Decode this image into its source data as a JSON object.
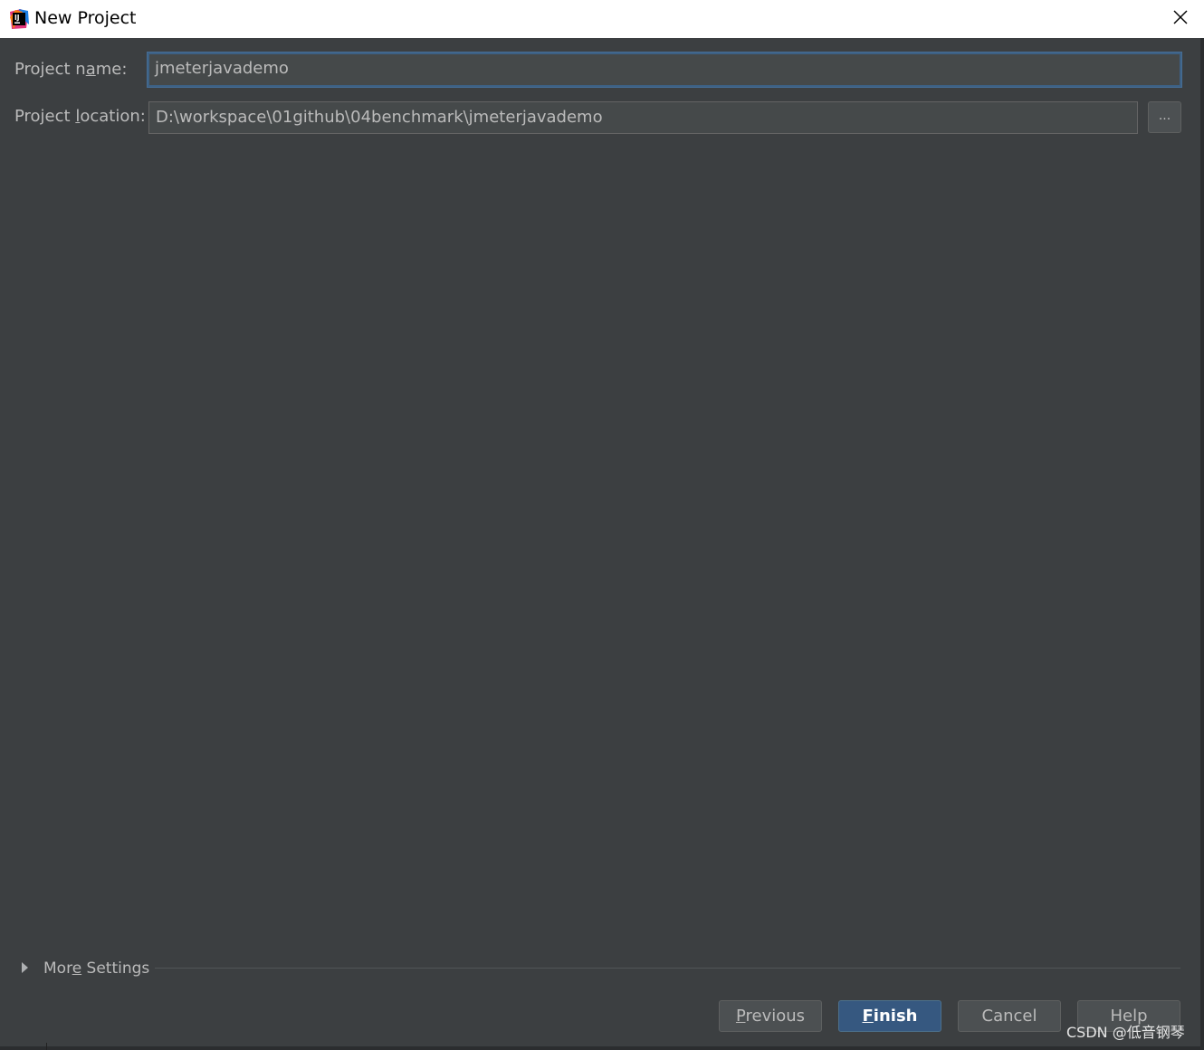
{
  "window": {
    "title": "New Project",
    "close_icon": "close-icon",
    "app_icon": "intellij-idea-icon"
  },
  "form": {
    "project_name_label_prefix": "Project n",
    "project_name_label_mnemonic": "a",
    "project_name_label_suffix": "me:",
    "project_name_value": "jmeterjavademo",
    "project_location_label_prefix": "Project ",
    "project_location_label_mnemonic": "l",
    "project_location_label_suffix": "ocation:",
    "project_location_value": "D:\\workspace\\01github\\04benchmark\\jmeterjavademo",
    "browse_label": "..."
  },
  "more_settings": {
    "label_prefix": "Mor",
    "label_mnemonic": "e",
    "label_suffix": " Settings",
    "expand_icon": "triangle-right-icon"
  },
  "buttons": {
    "previous_mnemonic": "P",
    "previous_rest": "revious",
    "finish_mnemonic": "F",
    "finish_rest": "inish",
    "cancel": "Cancel",
    "help": "Help"
  },
  "watermark": "CSDN @低音钢琴",
  "colors": {
    "background": "#3c3f41",
    "field_bg": "#45494a",
    "focus_border": "#3d6185",
    "primary_button": "#365880",
    "text": "#bbbbbb"
  }
}
